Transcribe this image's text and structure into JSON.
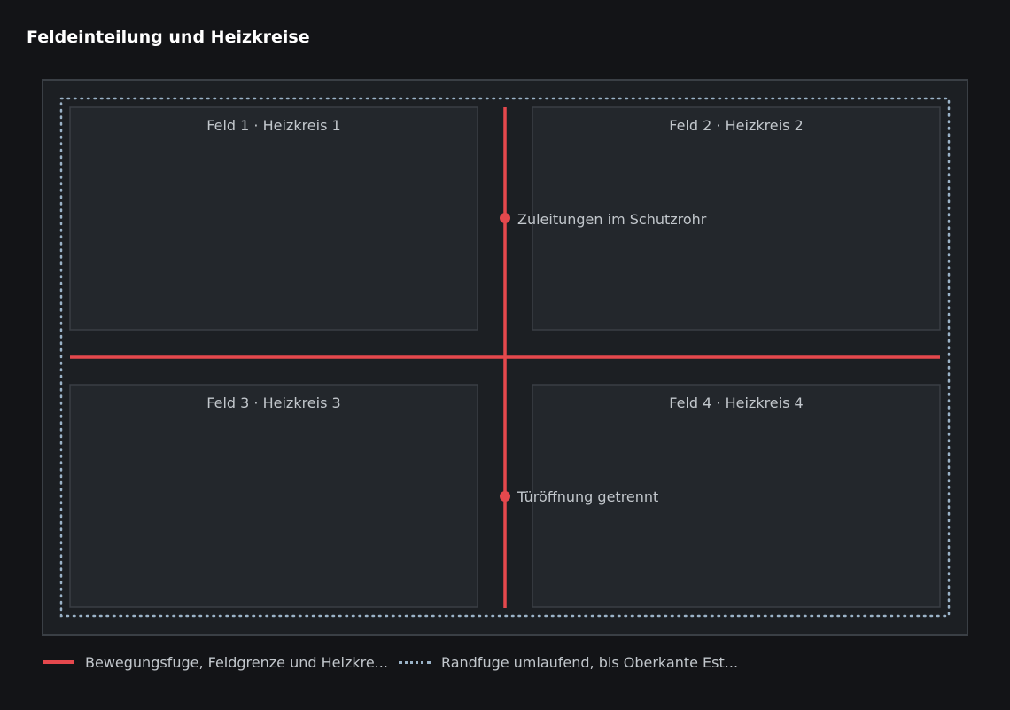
{
  "title": "Feldeinteilung und Heizkreise",
  "colors": {
    "background": "#131417",
    "room_border": "#3a3f45",
    "room_fill": "#1c1f23",
    "field_fill": "#23272c",
    "field_border": "#3a3f45",
    "movement_joint": "#e5484d",
    "edge_joint": "#9bb3c8"
  },
  "fields": [
    {
      "label": "Feld 1 · Heizkreis 1"
    },
    {
      "label": "Feld 2 · Heizkreis 2"
    },
    {
      "label": "Feld 3 · Heizkreis 3"
    },
    {
      "label": "Feld 4 · Heizkreis 4"
    }
  ],
  "annotations": {
    "upper": "Zuleitungen im Schutzrohr",
    "lower": "Türöffnung getrennt"
  },
  "legend": {
    "movement_joint": "Bewegungsfuge, Feldgrenze und Heizkre...",
    "edge_joint": "Randfuge umlaufend, bis Oberkante Est..."
  }
}
